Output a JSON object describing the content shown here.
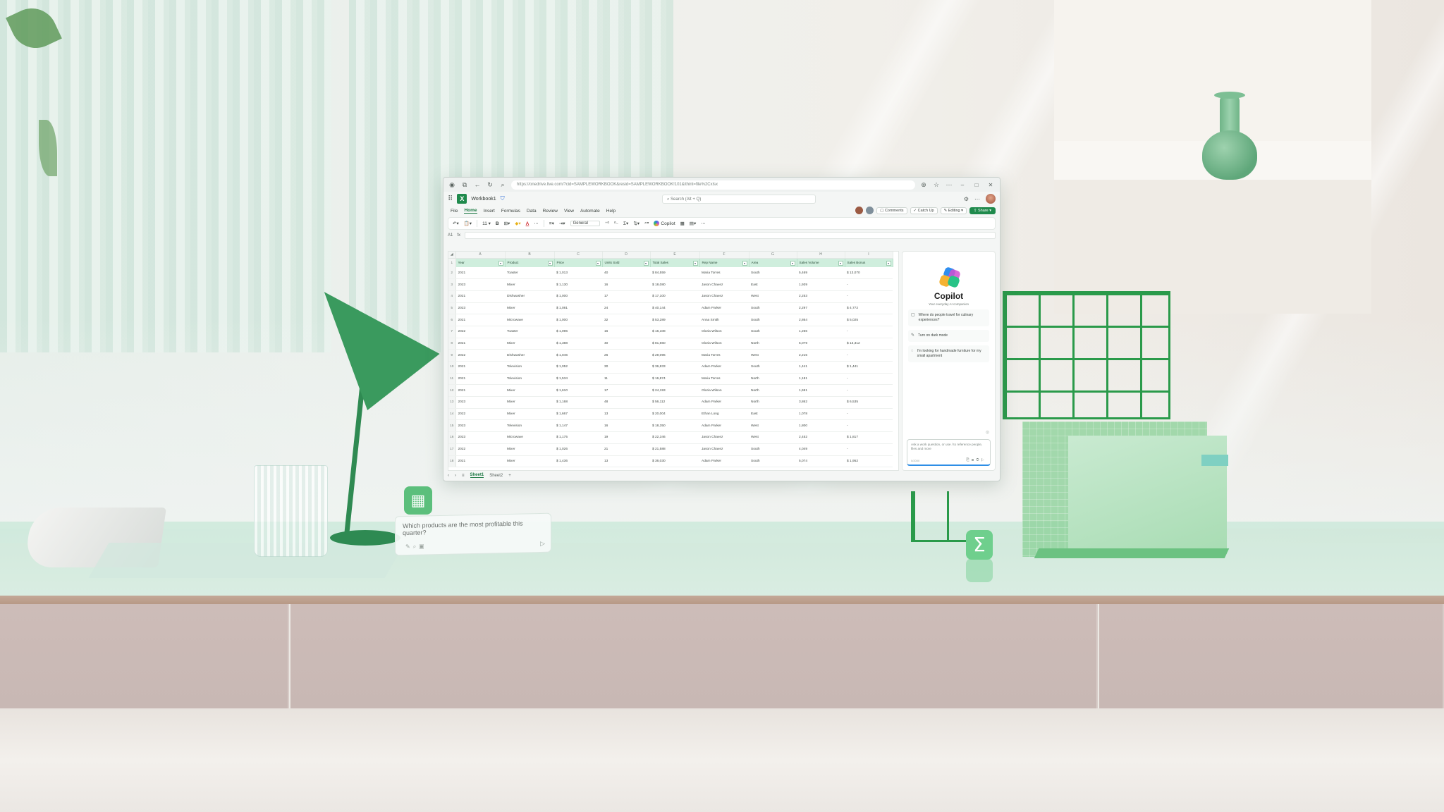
{
  "browser": {
    "url": "https://onedrive.live.com/?cid=SAMPLEWORKBOOK&resid=SAMPLEWORKBOOK!101&ithint=file%2Cxlsx",
    "icons": [
      "profile-icon",
      "tabs-icon",
      "back-icon",
      "refresh-icon",
      "lock-icon",
      "extensions-icon",
      "favorites-icon",
      "more-icon",
      "minimize-icon",
      "maximize-icon",
      "close-icon"
    ]
  },
  "app": {
    "workbook_name": "Workbook1",
    "search_placeholder": "Search (Alt + Q)",
    "brand_color": "#1f8a4c"
  },
  "menu": {
    "items": [
      "File",
      "Home",
      "Insert",
      "Formulas",
      "Data",
      "Review",
      "View",
      "Automate",
      "Help"
    ],
    "active": "Home",
    "comments_label": "Comments",
    "catchup_label": "Catch Up",
    "editing_label": "Editing",
    "share_label": "Share"
  },
  "ribbon": {
    "font_size": "11",
    "number_format": "General",
    "copilot_label": "Copilot"
  },
  "formula_bar": {
    "cell_ref": "A1",
    "fx": "fx"
  },
  "sheet": {
    "columns": [
      "A",
      "B",
      "C",
      "D",
      "E",
      "F",
      "G",
      "H",
      "I"
    ],
    "headers": [
      "Year",
      "Product",
      "Price",
      "Units Sold",
      "Total Sales",
      "Rep Name",
      "Area",
      "Sales Volume",
      "Sales Bonus"
    ],
    "rows": [
      [
        "2021",
        "Toaster",
        "$ 1,013",
        "40",
        "$ 84,559",
        "Maria Torres",
        "South",
        "5,469",
        "$ 13,070"
      ],
      [
        "2023",
        "Mixer",
        "$ 1,130",
        "16",
        "$ 18,080",
        "Jason Chavez",
        "East",
        "1,939",
        "-"
      ],
      [
        "2021",
        "Dishwasher",
        "$ 1,000",
        "17",
        "$ 17,100",
        "Jason Chavez",
        "West",
        "2,253",
        "-"
      ],
      [
        "2023",
        "Mixer",
        "$ 1,081",
        "24",
        "$ 40,144",
        "Adam Parker",
        "South",
        "2,297",
        "$ 4,772"
      ],
      [
        "2021",
        "Microwave",
        "$ 1,000",
        "32",
        "$ 53,289",
        "Anna Smith",
        "South",
        "2,864",
        "$ 5,025"
      ],
      [
        "2022",
        "Toaster",
        "$ 1,096",
        "16",
        "$ 16,108",
        "Gloria Wilson",
        "South",
        "1,266",
        "-"
      ],
      [
        "2021",
        "Mixer",
        "$ 1,388",
        "40",
        "$ 81,660",
        "Gloria Wilson",
        "North",
        "5,079",
        "$ 13,312"
      ],
      [
        "2022",
        "Dishwasher",
        "$ 1,046",
        "26",
        "$ 29,096",
        "Maria Torres",
        "West",
        "2,215",
        "-"
      ],
      [
        "2021",
        "Television",
        "$ 1,052",
        "30",
        "$ 36,833",
        "Adam Parker",
        "South",
        "1,441",
        "$ 1,441"
      ],
      [
        "2021",
        "Television",
        "$ 1,534",
        "11",
        "$ 16,874",
        "Maria Torres",
        "North",
        "1,181",
        "-"
      ],
      [
        "2021",
        "Mixer",
        "$ 1,610",
        "17",
        "$ 24,193",
        "Gloria Wilson",
        "North",
        "1,691",
        "-"
      ],
      [
        "2023",
        "Mixer",
        "$ 1,168",
        "48",
        "$ 56,112",
        "Adam Parker",
        "North",
        "3,862",
        "$ 6,535"
      ],
      [
        "2022",
        "Mixer",
        "$ 1,667",
        "13",
        "$ 20,004",
        "Ethan Long",
        "East",
        "1,078",
        "-"
      ],
      [
        "2023",
        "Television",
        "$ 1,147",
        "16",
        "$ 18,350",
        "Adam Parker",
        "West",
        "1,800",
        "-"
      ],
      [
        "2023",
        "Microwave",
        "$ 1,175",
        "19",
        "$ 22,346",
        "Jason Chavez",
        "West",
        "2,452",
        "$ 1,817"
      ],
      [
        "2022",
        "Mixer",
        "$ 1,026",
        "21",
        "$ 21,588",
        "Jason Chavez",
        "South",
        "4,049",
        "-"
      ],
      [
        "2021",
        "Mixer",
        "$ 1,436",
        "13",
        "$ 36,030",
        "Adam Parker",
        "South",
        "5,074",
        "$ 1,952"
      ]
    ],
    "tabs": [
      "Sheet1",
      "Sheet2"
    ],
    "active_tab": "Sheet1"
  },
  "copilot": {
    "title": "Copilot",
    "subtitle": "Your everyday AI companion",
    "suggestions": [
      {
        "icon": "clipboard-icon",
        "text": "Where do people travel for culinary experiences?"
      },
      {
        "icon": "pen-icon",
        "text": "Turn on dark mode"
      },
      {
        "icon": "lightbulb-icon",
        "text": "I'm looking for handmade furniture for my small apartment"
      }
    ],
    "input_placeholder": "Ask a work question, or use / to reference people, files and more",
    "char_count": "0/2000"
  },
  "floating_prompt": {
    "text": "Which products are the most profitable this quarter?"
  }
}
